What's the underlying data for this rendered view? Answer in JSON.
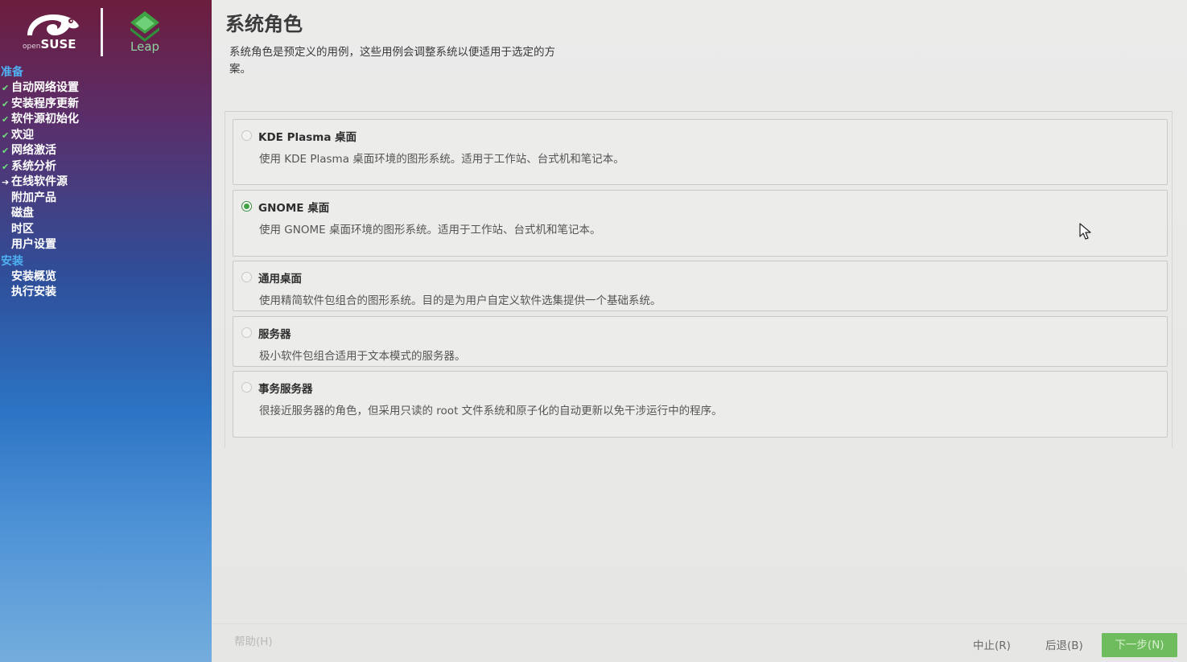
{
  "brand": {
    "opensuse_small": "open",
    "opensuse_word": "SUSE",
    "leap": "Leap",
    "accent_green": "#6fe07d",
    "header_blue": "#4fb0f2"
  },
  "steps": {
    "prepare_header": "准备",
    "prepare": [
      {
        "label": "自动网络设置",
        "state": "done"
      },
      {
        "label": "安装程序更新",
        "state": "done"
      },
      {
        "label": "软件源初始化",
        "state": "done"
      },
      {
        "label": "欢迎",
        "state": "done"
      },
      {
        "label": "网络激活",
        "state": "done"
      },
      {
        "label": "系统分析",
        "state": "done"
      },
      {
        "label": "在线软件源",
        "state": "current"
      },
      {
        "label": "附加产品",
        "state": "pending"
      },
      {
        "label": "磁盘",
        "state": "pending"
      },
      {
        "label": "时区",
        "state": "pending"
      },
      {
        "label": "用户设置",
        "state": "pending"
      }
    ],
    "install_header": "安装",
    "install": [
      {
        "label": "安装概览",
        "state": "pending"
      },
      {
        "label": "执行安装",
        "state": "pending"
      }
    ]
  },
  "main": {
    "title": "系统角色",
    "description": "系统角色是预定义的用例，这些用例会调整系统以便适用于选定的方案。",
    "roles": [
      {
        "label": "KDE Plasma 桌面",
        "desc": "使用 KDE Plasma 桌面环境的图形系统。适用于工作站、台式机和笔记本。",
        "selected": false
      },
      {
        "label": "GNOME 桌面",
        "desc": "使用 GNOME 桌面环境的图形系统。适用于工作站、台式机和笔记本。",
        "selected": true
      },
      {
        "label": "通用桌面",
        "desc": "使用精简软件包组合的图形系统。目的是为用户自定义软件选集提供一个基础系统。",
        "selected": false
      },
      {
        "label": "服务器",
        "desc": "极小软件包组合适用于文本模式的服务器。",
        "selected": false
      },
      {
        "label": "事务服务器",
        "desc": "很接近服务器的角色，但采用只读的 root 文件系统和原子化的自动更新以免干涉运行中的程序。",
        "selected": false
      }
    ]
  },
  "footer": {
    "help": "帮助(H)",
    "abort": "中止(R)",
    "back": "后退(B)",
    "next": "下一步(N)",
    "next_color": "#6fbc5f"
  }
}
